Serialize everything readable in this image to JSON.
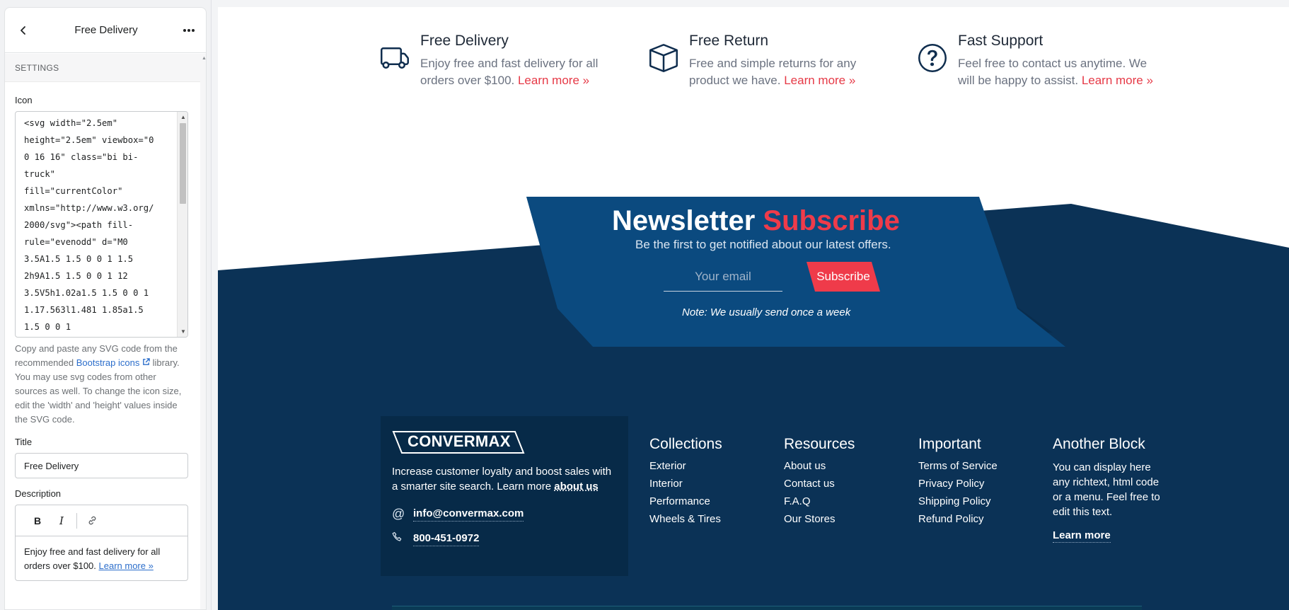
{
  "sidebar": {
    "header_title": "Free Delivery",
    "section_label": "SETTINGS",
    "icon_label": "Icon",
    "icon_code": "<svg width=\"2.5em\"\nheight=\"2.5em\" viewbox=\"0\n0 16 16\" class=\"bi bi-\ntruck\"\nfill=\"currentColor\"\nxmlns=\"http://www.w3.org/\n2000/svg\"><path fill-\nrule=\"evenodd\" d=\"M0\n3.5A1.5 1.5 0 0 1 1.5\n2h9A1.5 1.5 0 0 1 12\n3.5V5h1.02a1.5 1.5 0 0 1\n1.17.563l1.481 1.85a1.5\n1.5 0 0 1",
    "help_prefix": "Copy and paste any SVG code from the recommended ",
    "help_link": "Bootstrap icons",
    "help_suffix": " library. You may use svg codes from other sources as well. To change the icon size, edit the 'width' and 'height' values inside the SVG code.",
    "title_label": "Title",
    "title_value": "Free Delivery",
    "description_label": "Description",
    "description_text": "Enjoy free and fast delivery for all orders over $100. ",
    "description_link": "Learn more »"
  },
  "features": [
    {
      "title": "Free Delivery",
      "text": "Enjoy free and fast delivery for all orders over $100. ",
      "link": "Learn more »",
      "icon": "truck-icon"
    },
    {
      "title": "Free Return",
      "text": "Free and simple returns for any product we have.  ",
      "link": "Learn more »",
      "icon": "box-icon"
    },
    {
      "title": "Fast Support",
      "text": "Feel free to contact us anytime. We will be happy to assist. ",
      "link": "Learn more »",
      "icon": "question-circle-icon"
    }
  ],
  "newsletter": {
    "title_main": "Newsletter ",
    "title_accent": "Subscribe",
    "subtitle": "Be the first to get notified about our latest offers.",
    "email_placeholder": "Your email",
    "button": "Subscribe",
    "note": "Note: We usually send once a week"
  },
  "footer": {
    "logo": "CONVERMAX",
    "about_text": "Increase customer loyalty and boost sales with a smarter site search. Learn more ",
    "about_link": "about us",
    "email": "info@convermax.com",
    "phone": "800-451-0972",
    "columns": [
      {
        "title": "Collections",
        "links": [
          "Exterior",
          "Interior",
          "Performance",
          "Wheels & Tires"
        ]
      },
      {
        "title": "Resources",
        "links": [
          "About us",
          "Contact us",
          "F.A.Q",
          "Our Stores"
        ]
      },
      {
        "title": "Important",
        "links": [
          "Terms of Service",
          "Privacy Policy",
          "Shipping Policy",
          "Refund Policy"
        ]
      }
    ],
    "another_block": {
      "title": "Another Block",
      "text": "You can display here any richtext, html code or a menu. Feel free to edit this text.",
      "link": "Learn more"
    }
  },
  "colors": {
    "navy": "#0b3256",
    "panel_blue": "#0b4a7f",
    "accent_red": "#ef3b4a",
    "link_blue": "#2c6ecb"
  }
}
